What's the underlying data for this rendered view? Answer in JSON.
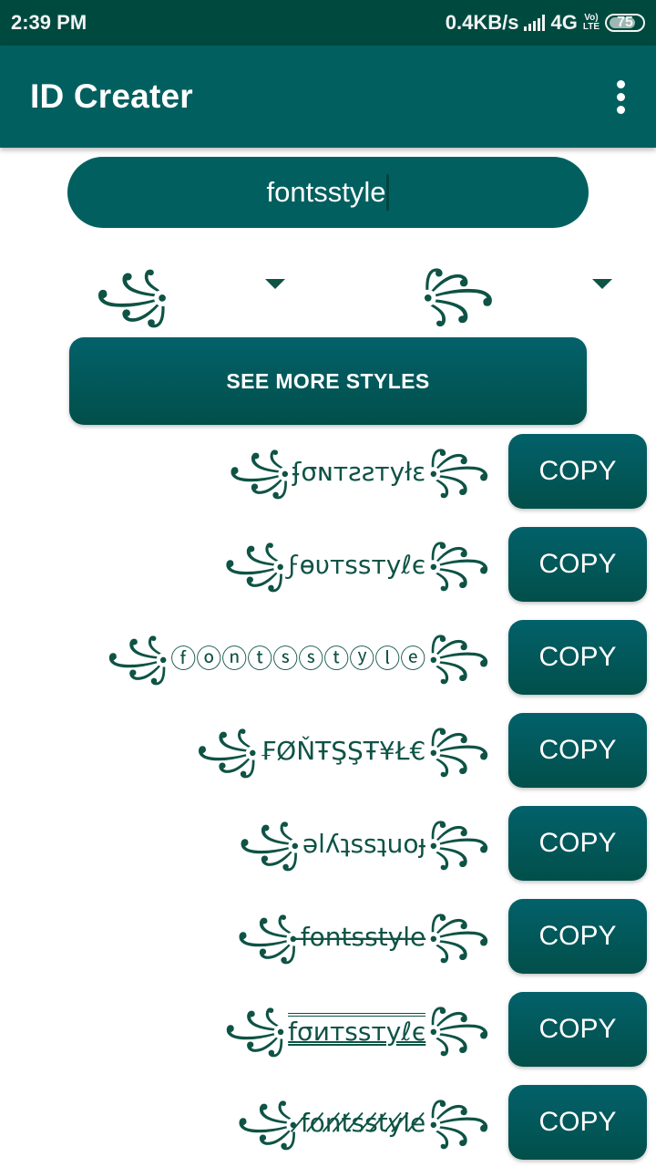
{
  "status_bar": {
    "time": "2:39 PM",
    "net_speed": "0.4KB/s",
    "network": "4G",
    "volte_top": "Vo)",
    "volte_bottom": "LTE",
    "battery": "75"
  },
  "app_bar": {
    "title": "ID Creater",
    "menu_icon": "more-vert-icon"
  },
  "name_input": {
    "value": "fontsstyle"
  },
  "spinners": {
    "left": {
      "selected": "꧁",
      "icon": "dropdown-arrow-icon"
    },
    "right": {
      "selected": "꧂",
      "icon": "dropdown-arrow-icon"
    }
  },
  "see_more_button": {
    "label": "SEE MORE STYLES"
  },
  "styles": [
    {
      "left": "꧁",
      "text": "ʄσɴтƨƨтуłɛ",
      "right": "꧂",
      "effect": "none",
      "copy_label": "COPY"
    },
    {
      "left": "꧁",
      "text": "ϝɵυтѕѕтуℓє",
      "right": "꧂",
      "effect": "none",
      "copy_label": "COPY"
    },
    {
      "left": "꧁",
      "text": "ⓕⓞⓝⓣⓢⓢⓣⓨⓛⓔ",
      "right": "꧂",
      "effect": "none",
      "copy_label": "COPY"
    },
    {
      "left": "꧁",
      "text": "₣ØŇŦŞŞŦ¥Ł€",
      "right": "꧂",
      "effect": "none",
      "copy_label": "COPY"
    },
    {
      "left": "꧁",
      "text": "ǝlʎʇssʇuoɟ",
      "right": "꧂",
      "effect": "none",
      "copy_label": "COPY"
    },
    {
      "left": "꧁",
      "text": "f̶o̶n̶t̶s̶s̶t̶y̶l̶e̶",
      "right": "꧂",
      "effect": "strike",
      "copy_label": "COPY"
    },
    {
      "left": "꧁",
      "text": "fσитѕѕтуℓє",
      "right": "꧂",
      "effect": "double-lines",
      "copy_label": "COPY"
    },
    {
      "left": "꧁",
      "text": "f̸o̸n̸t̸s̸s̸t̸y̸l̸e̸",
      "right": "꧂",
      "effect": "slash",
      "copy_label": "COPY"
    }
  ],
  "colors": {
    "status_bar": "#00493f",
    "primary": "#01605f",
    "button_top": "#02616a",
    "button_bottom": "#024f4a",
    "ornament": "#0e5345"
  }
}
